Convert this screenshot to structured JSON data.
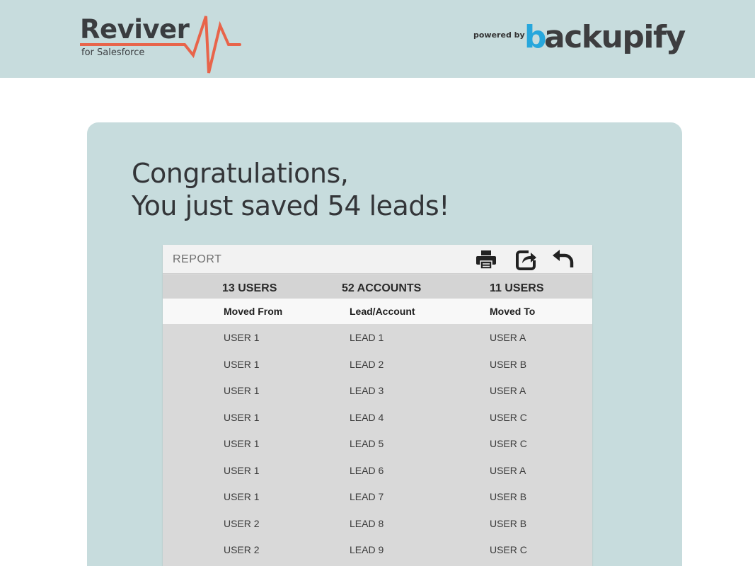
{
  "header": {
    "logo_name": "Reviver",
    "logo_sub": "for Salesforce",
    "powered_by": "powered by",
    "brand_first": "b",
    "brand_rest": "ackupify",
    "colors": {
      "bar": "#c7dcdd",
      "pulse": "#e8644a",
      "brand_accent": "#27a7dc"
    }
  },
  "main": {
    "headline_line1": "Congratulations,",
    "headline_line2": "You just saved 54 leads!"
  },
  "report": {
    "title": "REPORT",
    "tools": [
      "print-icon",
      "share-icon",
      "undo-icon"
    ],
    "summary": {
      "from": "13 USERS",
      "items": "52 ACCOUNTS",
      "to": "11 USERS"
    },
    "columns": [
      "Moved From",
      "Lead/Account",
      "Moved To"
    ],
    "rows": [
      [
        "USER 1",
        "LEAD 1",
        "USER A"
      ],
      [
        "USER 1",
        "LEAD 2",
        "USER B"
      ],
      [
        "USER 1",
        "LEAD 3",
        "USER A"
      ],
      [
        "USER 1",
        "LEAD 4",
        "USER C"
      ],
      [
        "USER 1",
        "LEAD 5",
        "USER C"
      ],
      [
        "USER 1",
        "LEAD 6",
        "USER A"
      ],
      [
        "USER 1",
        "LEAD 7",
        "USER B"
      ],
      [
        "USER 2",
        "LEAD 8",
        "USER B"
      ],
      [
        "USER 2",
        "LEAD 9",
        "USER C"
      ]
    ]
  }
}
